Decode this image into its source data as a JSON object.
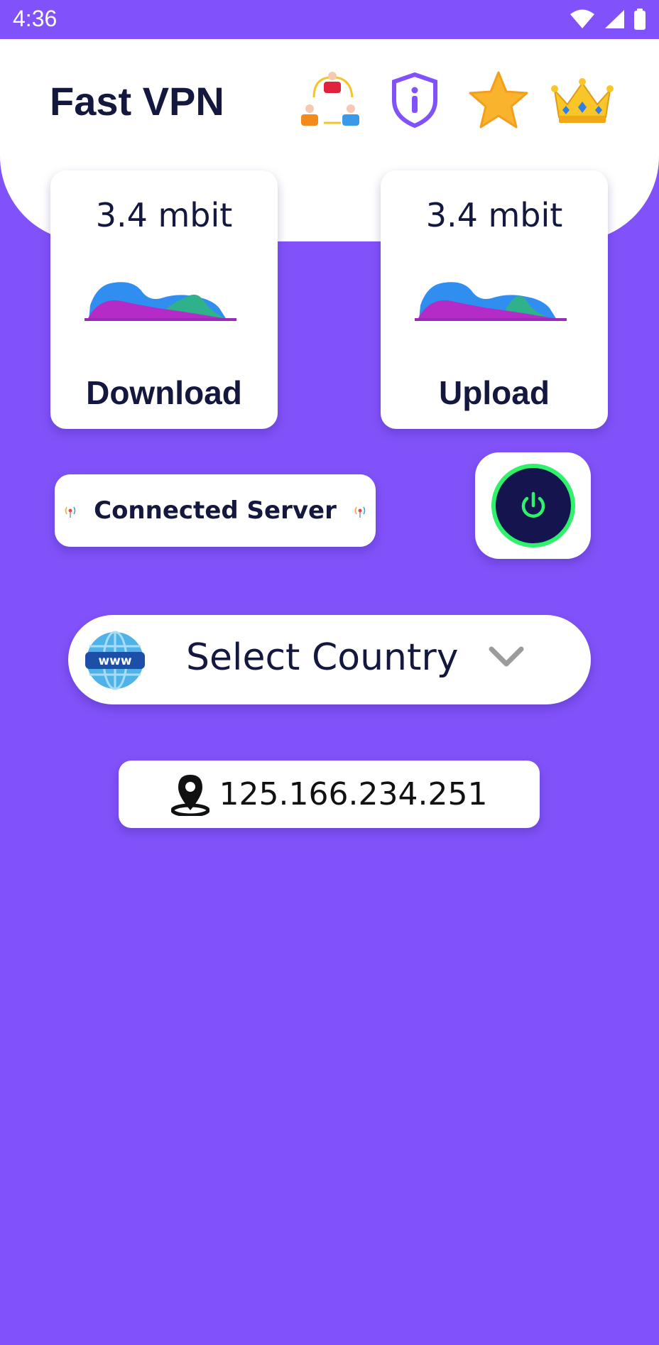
{
  "status_bar": {
    "time": "4:36",
    "icons": [
      "wifi-icon",
      "signal-icon",
      "battery-icon"
    ]
  },
  "header": {
    "title": "Fast VPN",
    "actions": [
      "share-users-icon",
      "shield-info-icon",
      "star-icon",
      "crown-icon"
    ]
  },
  "download": {
    "value": "3.4 mbit",
    "label": "Download",
    "graph_icon": "speed-graph-icon"
  },
  "upload": {
    "value": "3.4 mbit",
    "label": "Upload",
    "graph_icon": "speed-graph-icon"
  },
  "server": {
    "label": "Connected Server",
    "icon": "signal-broadcast-icon"
  },
  "power": {
    "icon": "power-icon",
    "state_color": "#2ff16b"
  },
  "country": {
    "label": "Select Country",
    "icon": "www-globe-icon",
    "dropdown_icon": "chevron-down-icon"
  },
  "ip": {
    "address": "125.166.234.251",
    "icon": "location-pin-icon"
  },
  "colors": {
    "background": "#8152f9",
    "text": "#14183f",
    "power_ring": "#2ff16b"
  }
}
